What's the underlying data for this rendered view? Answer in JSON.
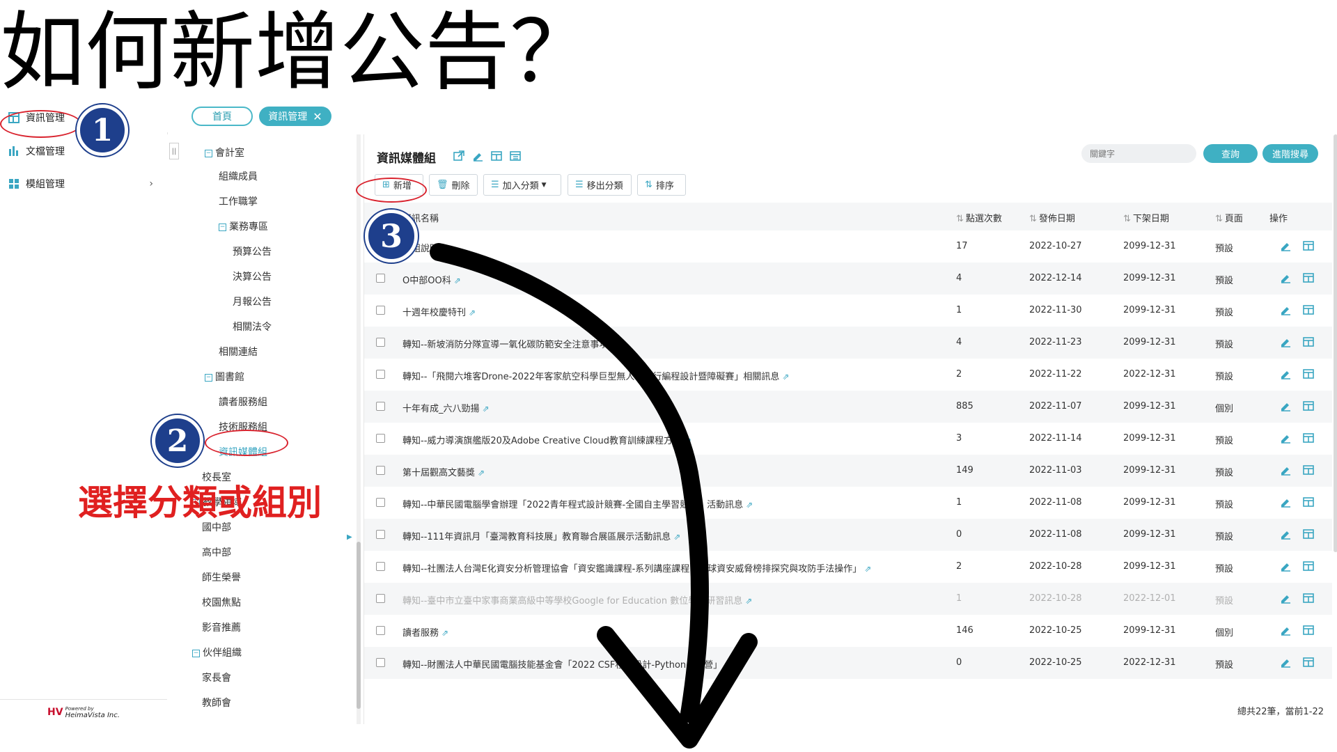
{
  "page_title": "如何新增公告？",
  "sidebar": {
    "items": [
      {
        "label": "資訊管理",
        "icon": "grid-icon"
      },
      {
        "label": "文檔管理",
        "icon": "bar-chart-icon"
      },
      {
        "label": "模組管理",
        "icon": "module-icon",
        "chevron": "›"
      }
    ],
    "footer_powered": "Powered by",
    "footer_company": "HeimaVista Inc."
  },
  "tabs": {
    "home": "首頁",
    "active": "資訊管理",
    "close": "✕"
  },
  "tree": {
    "collapse_glyph": "||",
    "nodes": [
      {
        "label": "會計室",
        "level": 1,
        "box": "⊟"
      },
      {
        "label": "組織成員",
        "level": 2
      },
      {
        "label": "工作職掌",
        "level": 2
      },
      {
        "label": "業務專區",
        "level": 2,
        "box": "⊟"
      },
      {
        "label": "預算公告",
        "level": 3
      },
      {
        "label": "決算公告",
        "level": 3
      },
      {
        "label": "月報公告",
        "level": 3
      },
      {
        "label": "相關法令",
        "level": 3
      },
      {
        "label": "相關連結",
        "level": 2
      },
      {
        "label": "圖書館",
        "level": 1,
        "box": "⊟"
      },
      {
        "label": "讀者服務組",
        "level": 2
      },
      {
        "label": "技術服務組",
        "level": 2
      },
      {
        "label": "資訊媒體組",
        "level": 2,
        "selected": true
      },
      {
        "label": "校長室",
        "level": 1
      },
      {
        "label": "教學領域",
        "level": 1,
        "box": "⊟"
      },
      {
        "label": "國中部",
        "level": 2
      },
      {
        "label": "高中部",
        "level": 2
      },
      {
        "label": "師生榮譽",
        "level": 1
      },
      {
        "label": "校園焦點",
        "level": 1
      },
      {
        "label": "影音推薦",
        "level": 1
      },
      {
        "label": "伙伴組織",
        "level": 1,
        "box": "⊟"
      },
      {
        "label": "家長會",
        "level": 2
      },
      {
        "label": "教師會",
        "level": 2
      }
    ]
  },
  "main": {
    "title": "資訊媒體組",
    "search_placeholder": "關鍵字",
    "search_button": "查詢",
    "advanced_search_button": "進階搜尋",
    "toolbar": {
      "add": "新增",
      "delete": "刪除",
      "add_category": "加入分類",
      "remove_category": "移出分類",
      "sort": "排序"
    },
    "columns": {
      "name": "資訊名稱",
      "clicks": "點選次數",
      "publish_date": "發佈日期",
      "unpublish_date": "下架日期",
      "page": "頁面",
      "actions": "操作"
    },
    "rows": [
      {
        "name": "本組說明",
        "clicks": "17",
        "publish": "2022-10-27",
        "unpublish": "2099-12-31",
        "page": "預設",
        "checkbox": false
      },
      {
        "name": "O中部OO科",
        "clicks": "4",
        "publish": "2022-12-14",
        "unpublish": "2099-12-31",
        "page": "預設",
        "checkbox": true
      },
      {
        "name": "十週年校慶特刊",
        "clicks": "1",
        "publish": "2022-11-30",
        "unpublish": "2099-12-31",
        "page": "預設",
        "checkbox": true
      },
      {
        "name": "轉知--新坡消防分隊宣導一氧化碳防範安全注意事項",
        "clicks": "4",
        "publish": "2022-11-23",
        "unpublish": "2099-12-31",
        "page": "預設",
        "checkbox": true
      },
      {
        "name": "轉知--「飛閱六堆客Drone-2022年客家航空科學巨型無人機飛行編程設計暨障礙賽」相關訊息",
        "clicks": "2",
        "publish": "2022-11-22",
        "unpublish": "2022-12-31",
        "page": "預設",
        "checkbox": true
      },
      {
        "name": "十年有成_六八勁揚",
        "clicks": "885",
        "publish": "2022-11-07",
        "unpublish": "2099-12-31",
        "page": "個別",
        "checkbox": true
      },
      {
        "name": "轉知--威力導演旗艦版20及Adobe Creative Cloud教育訓練課程方案",
        "clicks": "3",
        "publish": "2022-11-14",
        "unpublish": "2099-12-31",
        "page": "預設",
        "checkbox": true
      },
      {
        "name": "第十屆觀高文藝獎",
        "clicks": "149",
        "publish": "2022-11-03",
        "unpublish": "2099-12-31",
        "page": "預設",
        "checkbox": true
      },
      {
        "name": "轉知--中華民國電腦學會辦理「2022青年程式設計競賽-全國自主學習競賽」活動訊息",
        "clicks": "1",
        "publish": "2022-11-08",
        "unpublish": "2099-12-31",
        "page": "預設",
        "checkbox": true
      },
      {
        "name": "轉知--111年資訊月「臺灣教育科技展」教育聯合展區展示活動訊息",
        "clicks": "0",
        "publish": "2022-11-08",
        "unpublish": "2099-12-31",
        "page": "預設",
        "checkbox": true
      },
      {
        "name": "轉知--社團法人台灣E化資安分析管理協會「資安鑑識課程-系列講座課程：全球資安威脅榜排探究與攻防手法操作」",
        "clicks": "2",
        "publish": "2022-10-28",
        "unpublish": "2099-12-31",
        "page": "預設",
        "checkbox": true
      },
      {
        "name": "轉知--臺中市立臺中家事商業高級中等學校Google for Education 數位學習研習訊息",
        "clicks": "1",
        "publish": "2022-10-28",
        "unpublish": "2022-12-01",
        "page": "預設",
        "checkbox": true,
        "dim": true
      },
      {
        "name": "讀者服務",
        "clicks": "146",
        "publish": "2022-10-25",
        "unpublish": "2099-12-31",
        "page": "個別",
        "checkbox": true
      },
      {
        "name": "轉知--財團法人中華民國電腦技能基金會「2022 CSF程式設計-Python冬季營」",
        "clicks": "0",
        "publish": "2022-10-25",
        "unpublish": "2022-12-31",
        "page": "預設",
        "checkbox": true
      }
    ],
    "footer": "總共22筆，當前1-22"
  },
  "annotations": {
    "badge_1": "1",
    "badge_2": "2",
    "badge_3": "3",
    "instruction": "選擇分類或組別",
    "accent_color": "#d9232e",
    "badge_color": "#1e3f8c"
  },
  "colors": {
    "primary": "#3fb0c3",
    "icon": "#3aa6c2"
  }
}
